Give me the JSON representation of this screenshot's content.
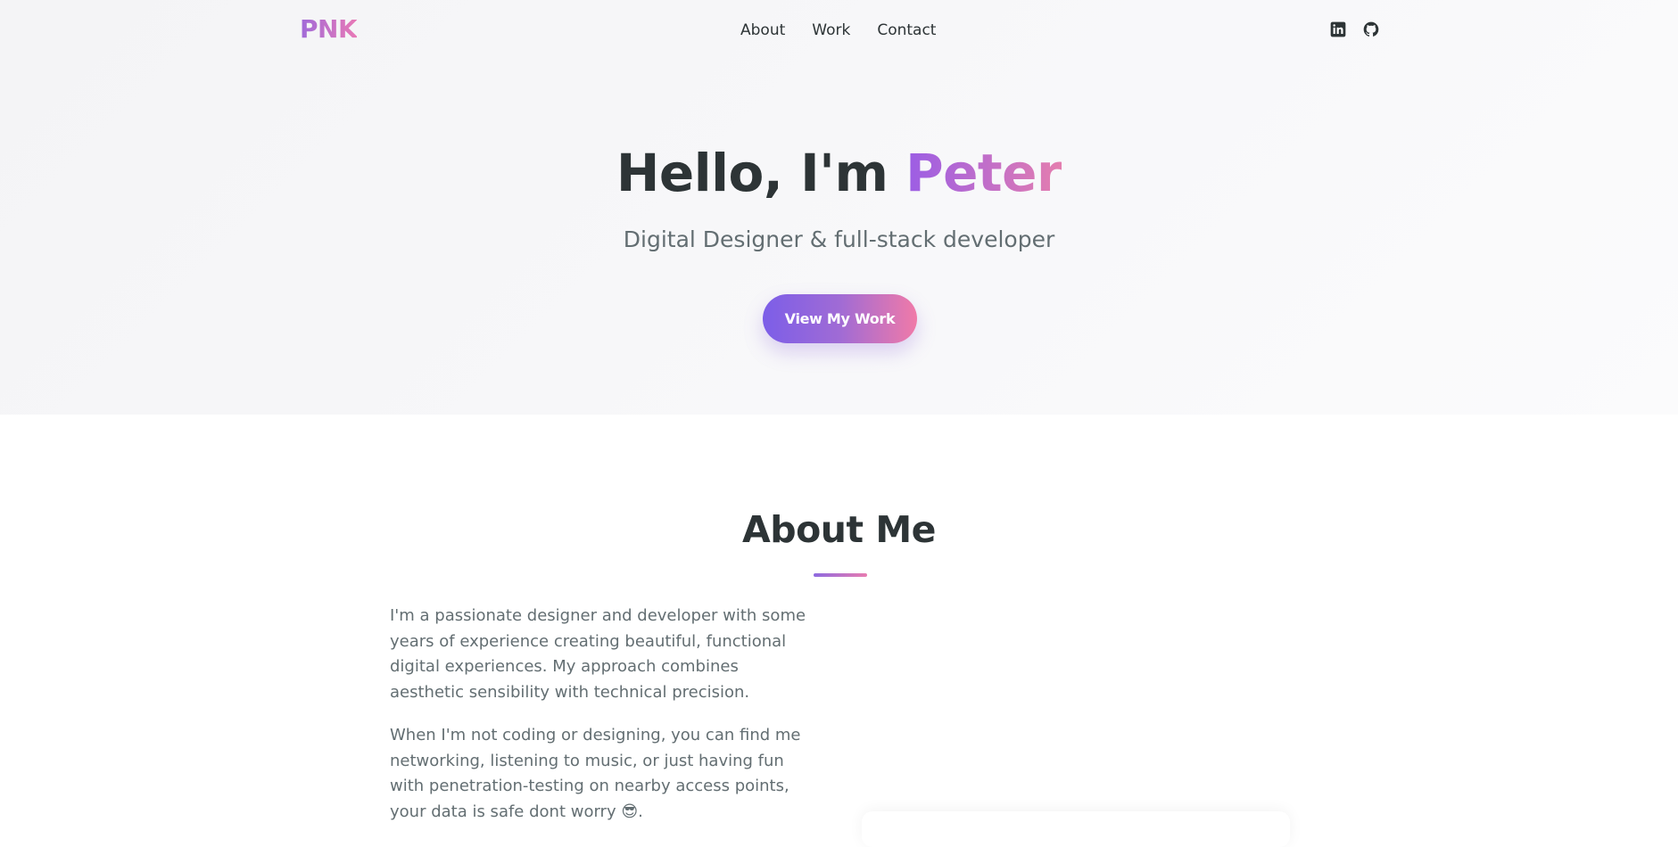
{
  "brand": {
    "logo": "PNK",
    "gradient_start": "#a06ad9",
    "gradient_end": "#e879b6"
  },
  "nav": {
    "links": [
      "About",
      "Work",
      "Contact"
    ],
    "social": [
      {
        "icon": "linkedin-icon"
      },
      {
        "icon": "github-icon"
      }
    ]
  },
  "hero": {
    "greeting": "Hello, I'm ",
    "name": "Peter",
    "subtitle": "Digital Designer & full-stack developer",
    "cta": "View My Work"
  },
  "about": {
    "heading": "About Me",
    "paragraphs": [
      "I'm a passionate designer and developer with some years of experience creating beautiful, functional digital experiences. My approach combines aesthetic sensibility with technical precision.",
      "When I'm not coding or designing, you can find me networking, listening to music, or just having fun with penetration-testing on nearby access points, your data is safe dont worry 😎."
    ]
  },
  "colors": {
    "text_dark": "#2d3436",
    "text_muted": "#636e72",
    "accent_purple": "#9b5de5",
    "accent_pink": "#e47eaf"
  }
}
